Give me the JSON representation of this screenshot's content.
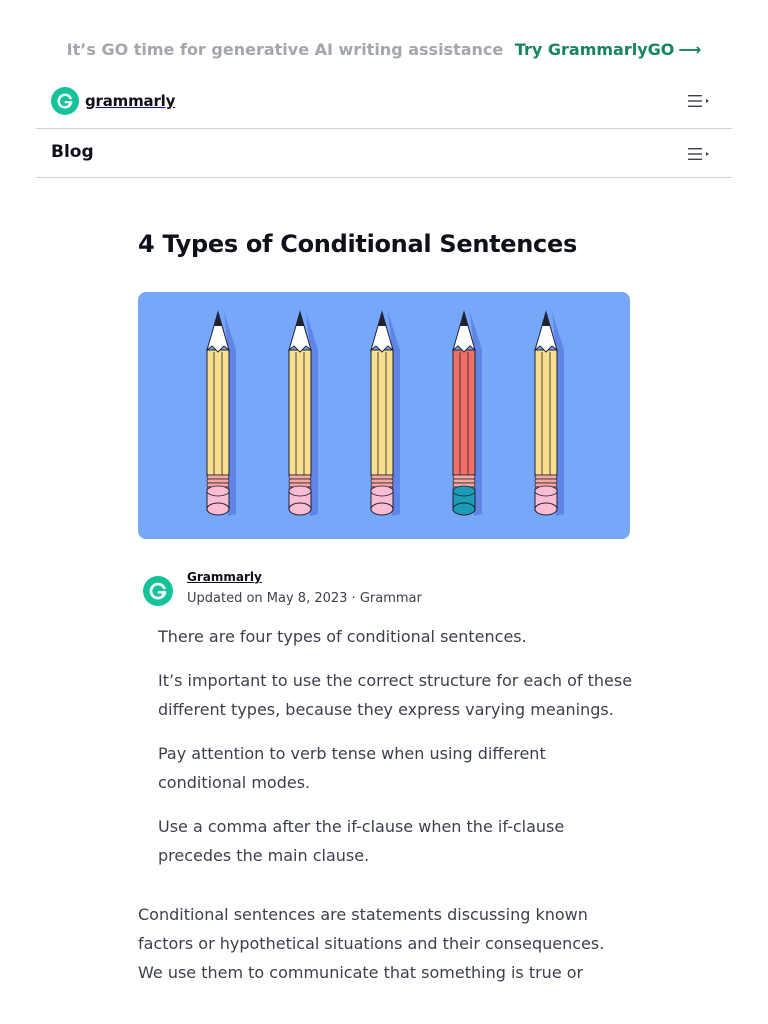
{
  "promo": {
    "text": "It’s GO time for generative AI writing assistance",
    "link": "Try GrammarlyGO",
    "arrow": "⟶"
  },
  "header": {
    "logo_text": "grammarly",
    "menu_icon": "menu-icon"
  },
  "blogbar": {
    "title": "Blog",
    "menu_icon": "menu-icon"
  },
  "article": {
    "title": "4 Types of Conditional Sentences",
    "hero_image": {
      "description_icon": "pencils-illustration",
      "pencil_count": 5,
      "highlighted_pencil": 4
    },
    "author": {
      "name": "Grammarly",
      "meta": "Updated on May 8, 2023 · Grammar"
    },
    "takeaways": [
      "There are four types of conditional sentences.",
      "It’s important to use the correct structure for each of these different types, because they express varying meanings.",
      "Pay attention to verb tense when using different conditional modes.",
      "Use a comma after the if-clause when the if-clause precedes the main clause."
    ],
    "intro": "Conditional sentences are statements discussing known factors or hypothetical situations and their consequences. We use them to communicate that something is true or"
  },
  "colors": {
    "brand_green": "#15c39a",
    "link_green": "#15845f",
    "hero_blue": "#76a7f8",
    "pencil_yellow": "#f8e08e",
    "pencil_red": "#f07065",
    "eraser_pink": "#fbbcd4",
    "eraser_teal": "#1b9db8"
  }
}
